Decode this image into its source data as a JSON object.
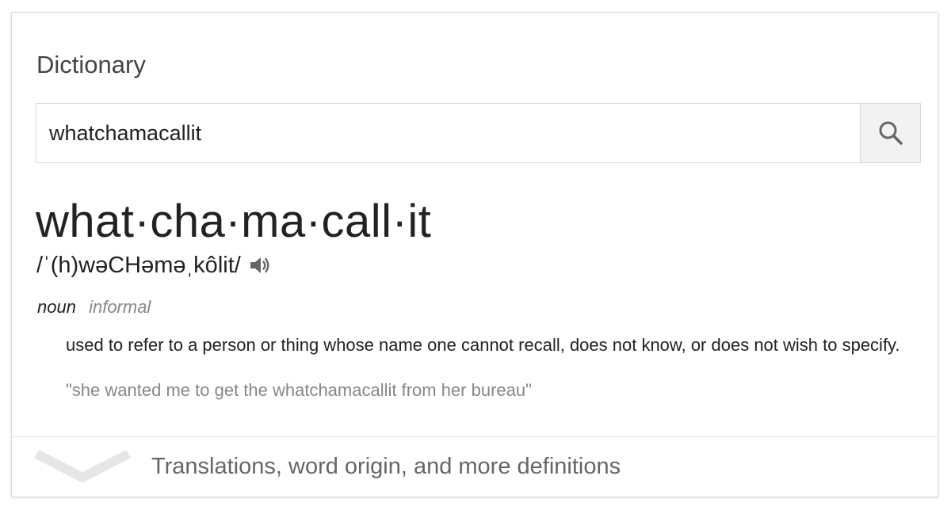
{
  "card": {
    "title": "Dictionary"
  },
  "search": {
    "value": "whatchamacallit",
    "button_icon": "search-icon"
  },
  "entry": {
    "headword": "what·cha·ma·call·it",
    "pronunciation": "/ˈ(h)wəCHəməˌkôlit/",
    "audio_icon": "speaker-icon",
    "part_of_speech": "noun",
    "register": "informal",
    "definition": "used to refer to a person or thing whose name one cannot recall, does not know, or does not wish to specify.",
    "example": "\"she wanted me to get the whatchamacallit from her bureau\""
  },
  "footer": {
    "more_label": "Translations, word origin, and more definitions",
    "expand_icon": "chevron-down-icon"
  },
  "colors": {
    "text_primary": "#222222",
    "text_muted": "#878787",
    "border": "#d9d9d9",
    "button_bg": "#f2f2f2"
  }
}
